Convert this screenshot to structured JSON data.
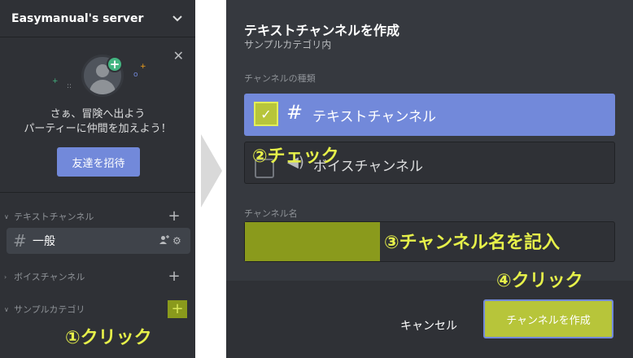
{
  "server": {
    "name": "Easymanual's server"
  },
  "invite": {
    "line1": "さぁ、冒険へ出よう",
    "line2": "パーティーに仲間を加えよう！",
    "button_label": "友達を招待"
  },
  "sidebar": {
    "categories": [
      {
        "label": "テキストチャンネル"
      },
      {
        "label": "ボイスチャンネル"
      },
      {
        "label": "サンプルカテゴリ"
      }
    ],
    "channels": [
      {
        "name": "一般"
      }
    ]
  },
  "modal": {
    "title": "テキストチャンネルを作成",
    "subtitle": "サンプルカテゴリ内",
    "type_label": "チャンネルの種類",
    "options": [
      {
        "label": "テキストチャンネル",
        "selected": true
      },
      {
        "label": "ボイスチャンネル",
        "selected": false
      }
    ],
    "name_label": "チャンネル名",
    "cancel_label": "キャンセル",
    "create_label": "チャンネルを作成"
  },
  "annotations": {
    "step1": "①クリック",
    "step2": "②チェック",
    "step3": "③チャンネル名を記入",
    "step4": "④クリック"
  },
  "colors": {
    "sidebar_bg": "#2f3136",
    "modal_bg": "#36393f",
    "blurple": "#7289da",
    "green": "#43b581",
    "highlight_olive": "#8a9a1c",
    "highlight_text": "#e6f04a"
  }
}
